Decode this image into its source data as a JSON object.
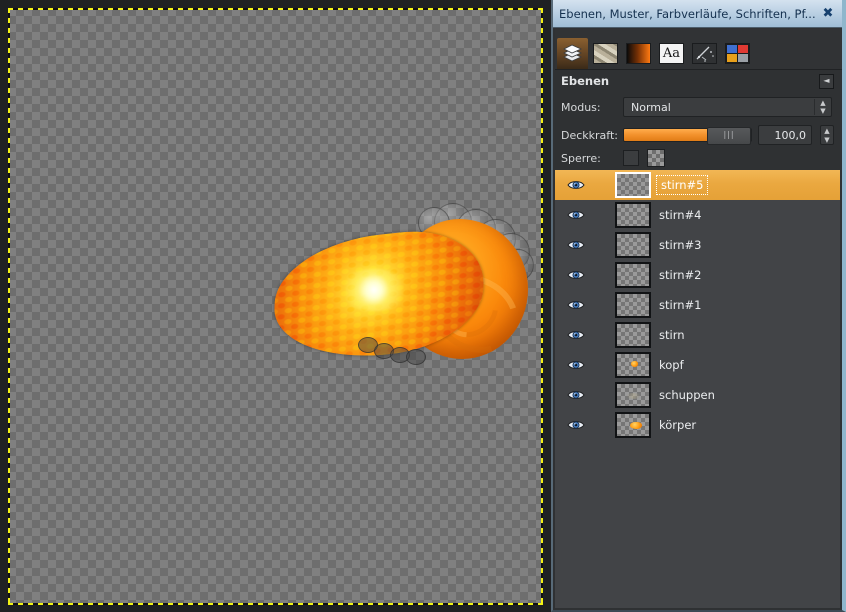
{
  "window": {
    "title": "Ebenen, Muster, Farbverläufe, Schriften, Pf...",
    "close_label": "✖",
    "close_icon": "close-icon"
  },
  "tabs": [
    {
      "name": "tab-layers",
      "icon": "layers-icon",
      "label": "Ebenen",
      "active": true
    },
    {
      "name": "tab-patterns",
      "icon": "pattern-icon",
      "label": "Muster",
      "active": false
    },
    {
      "name": "tab-gradients",
      "icon": "gradient-icon",
      "label": "Farbverläufe",
      "active": false
    },
    {
      "name": "tab-fonts",
      "icon": "font-icon",
      "label": "Aa",
      "active": false
    },
    {
      "name": "tab-brushes",
      "icon": "brush-icon",
      "label": "Pinsel",
      "active": false
    },
    {
      "name": "tab-colors",
      "icon": "colors-icon",
      "label": "Farben",
      "active": false
    }
  ],
  "panel": {
    "title": "Ebenen",
    "menu_button_icon": "panel-menu-icon",
    "menu_button_glyph": "◄"
  },
  "controls": {
    "mode_label": "Modus:",
    "mode_value": "Normal",
    "opacity_label": "Deckkraft:",
    "opacity_value": "100,0",
    "opacity_percent": 100,
    "lock_label": "Sperre:",
    "lock_pixels_checked": false,
    "lock_alpha_checked": false
  },
  "layers": [
    {
      "name": "stirn#5",
      "visible": true,
      "selected": true,
      "thumb": "empty"
    },
    {
      "name": "stirn#4",
      "visible": true,
      "selected": false,
      "thumb": "empty"
    },
    {
      "name": "stirn#3",
      "visible": true,
      "selected": false,
      "thumb": "empty"
    },
    {
      "name": "stirn#2",
      "visible": true,
      "selected": false,
      "thumb": "empty"
    },
    {
      "name": "stirn#1",
      "visible": true,
      "selected": false,
      "thumb": "empty"
    },
    {
      "name": "stirn",
      "visible": true,
      "selected": false,
      "thumb": "empty"
    },
    {
      "name": "kopf",
      "visible": true,
      "selected": false,
      "thumb": "small"
    },
    {
      "name": "schuppen",
      "visible": true,
      "selected": false,
      "thumb": "faint"
    },
    {
      "name": "körper",
      "visible": true,
      "selected": false,
      "thumb": "blob"
    }
  ],
  "colors": {
    "selection_orange": "#eaa840",
    "slider_orange": "#f2912c",
    "titlebar_blue": "#b6cde1",
    "panel_bg": "#2f3133",
    "list_bg": "#424447",
    "marching_ants_yellow": "#f2f215"
  },
  "canvas": {
    "description": "Transparent checkerboard canvas with orange scaled fish artwork",
    "selection_active": true
  },
  "tab_color_swatches": [
    "#3f6fd0",
    "#e03a33",
    "#e8a01b",
    "#9aa0a6"
  ]
}
